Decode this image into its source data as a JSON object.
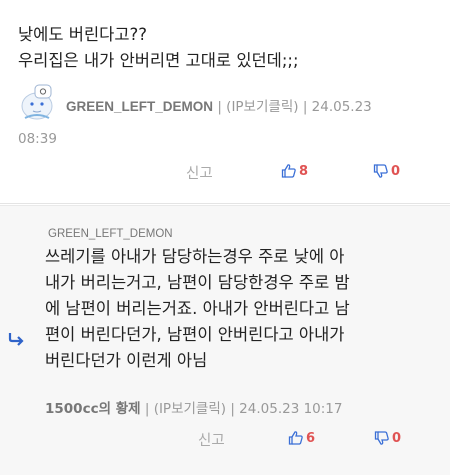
{
  "comment": {
    "lines": [
      "낮에도 버린다고??",
      "우리집은 내가 안버리면 고대로 있던데;;;"
    ],
    "author": "GREEN_LEFT_DEMON",
    "ip": "(IP보기클릭)",
    "date": "24.05.23",
    "time": "08:39",
    "report_label": "신고",
    "upvotes": "8",
    "downvotes": "0"
  },
  "reply": {
    "reply_to": "GREEN_LEFT_DEMON",
    "lines": [
      "쓰레기를 아내가 담당하는경우 주로 낮에 아",
      "내가 버리는거고, 남편이 담당한경우 주로 밤",
      "에 남편이 버리는거죠. 아내가 안버린다고 남",
      "편이 버린다던가, 남편이 안버린다고 아내가",
      "버린다던가 이런게 아님"
    ],
    "author": "1500cc의 황제",
    "ip": "(IP보기클릭)",
    "datetime": "24.05.23 10:17",
    "report_label": "신고",
    "upvotes": "6",
    "downvotes": "0"
  },
  "colors": {
    "vote_count": "#e05353",
    "thumb_icon": "#3b6fd6",
    "reply_arrow": "#2f63c9"
  },
  "icons": {
    "upvote": "thumbs-up-icon",
    "downvote": "thumbs-down-icon",
    "reply_marker": "reply-arrow-icon",
    "avatar": "user-avatar-icon"
  }
}
